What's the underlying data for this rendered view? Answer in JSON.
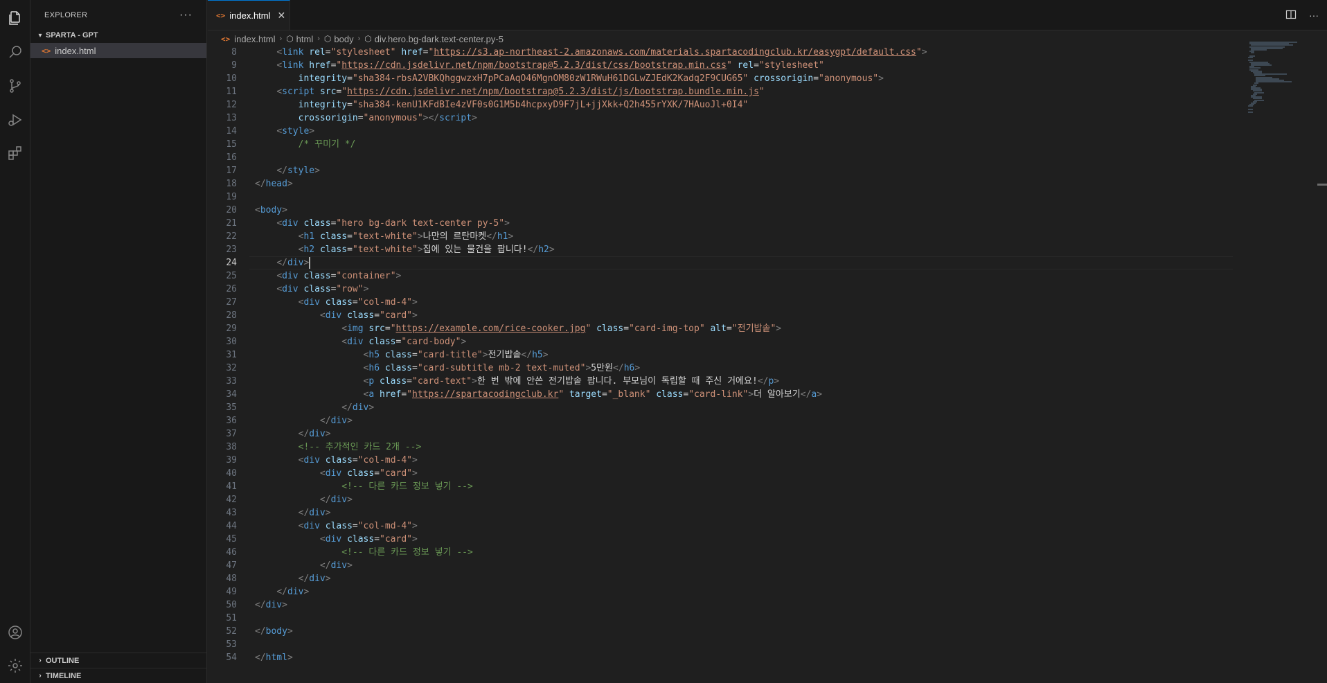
{
  "explorer": {
    "title": "EXPLORER",
    "more": "···",
    "project": "SPARTA - GPT",
    "files": [
      "index.html"
    ],
    "outline": "OUTLINE",
    "timeline": "TIMELINE"
  },
  "tab": {
    "label": "index.html",
    "close": "✕"
  },
  "breadcrumb": [
    "index.html",
    "html",
    "body",
    "div.hero.bg-dark.text-center.py-5"
  ],
  "editor": {
    "current_line": 24,
    "lines": [
      {
        "n": "8",
        "html": "    <span class='tg'>&lt;</span><span class='t'>link</span> <span class='at'>rel</span>=<span class='v'>\"stylesheet\"</span> <span class='at'>href</span>=<span class='v'>\"</span><span class='u'>https://s3.ap-northeast-2.amazonaws.com/materials.spartacodingclub.kr/easygpt/default.css</span><span class='v'>\"</span><span class='tg'>&gt;</span>"
      },
      {
        "n": "9",
        "html": "    <span class='tg'>&lt;</span><span class='t'>link</span> <span class='at'>href</span>=<span class='v'>\"</span><span class='u'>https://cdn.jsdelivr.net/npm/bootstrap@5.2.3/dist/css/bootstrap.min.css</span><span class='v'>\"</span> <span class='at'>rel</span>=<span class='v'>\"stylesheet\"</span>"
      },
      {
        "n": "10",
        "html": "        <span class='at'>integrity</span>=<span class='v'>\"sha384-rbsA2VBKQhggwzxH7pPCaAqO46MgnOM80zW1RWuH61DGLwZJEdK2Kadq2F9CUG65\"</span> <span class='at'>crossorigin</span>=<span class='v'>\"anonymous\"</span><span class='tg'>&gt;</span>"
      },
      {
        "n": "11",
        "html": "    <span class='tg'>&lt;</span><span class='t'>script</span> <span class='at'>src</span>=<span class='v'>\"</span><span class='u'>https://cdn.jsdelivr.net/npm/bootstrap@5.2.3/dist/js/bootstrap.bundle.min.js</span><span class='v'>\"</span>"
      },
      {
        "n": "12",
        "html": "        <span class='at'>integrity</span>=<span class='v'>\"sha384-kenU1KFdBIe4zVF0s0G1M5b4hcpxyD9F7jL+jjXkk+Q2h455rYXK/7HAuoJl+0I4\"</span>"
      },
      {
        "n": "13",
        "html": "        <span class='at'>crossorigin</span>=<span class='v'>\"anonymous\"</span><span class='tg'>&gt;&lt;/</span><span class='t'>script</span><span class='tg'>&gt;</span>"
      },
      {
        "n": "14",
        "html": "    <span class='tg'>&lt;</span><span class='t'>style</span><span class='tg'>&gt;</span>"
      },
      {
        "n": "15",
        "html": "        <span class='c'>/* 꾸미기 */</span>"
      },
      {
        "n": "16",
        "html": ""
      },
      {
        "n": "17",
        "html": "    <span class='tg'>&lt;/</span><span class='t'>style</span><span class='tg'>&gt;</span>"
      },
      {
        "n": "18",
        "html": "<span class='tg'>&lt;/</span><span class='t'>head</span><span class='tg'>&gt;</span>"
      },
      {
        "n": "19",
        "html": ""
      },
      {
        "n": "20",
        "html": "<span class='tg'>&lt;</span><span class='t'>body</span><span class='tg'>&gt;</span>"
      },
      {
        "n": "21",
        "html": "    <span class='tg'>&lt;</span><span class='t'>div</span> <span class='at'>class</span>=<span class='v'>\"hero bg-dark text-center py-5\"</span><span class='tg'>&gt;</span>"
      },
      {
        "n": "22",
        "html": "        <span class='tg'>&lt;</span><span class='t'>h1</span> <span class='at'>class</span>=<span class='v'>\"text-white\"</span><span class='tg'>&gt;</span><span class='w'>나만의 르탄마켓</span><span class='tg'>&lt;/</span><span class='t'>h1</span><span class='tg'>&gt;</span>"
      },
      {
        "n": "23",
        "html": "        <span class='tg'>&lt;</span><span class='t'>h2</span> <span class='at'>class</span>=<span class='v'>\"text-white\"</span><span class='tg'>&gt;</span><span class='w'>집에 있는 물건을 팝니다!</span><span class='tg'>&lt;/</span><span class='t'>h2</span><span class='tg'>&gt;</span>"
      },
      {
        "n": "24",
        "html": "    <span class='tg'>&lt;/</span><span class='t'>div</span><span class='tg'>&gt;</span><span class='cursor'></span>"
      },
      {
        "n": "25",
        "html": "    <span class='tg'>&lt;</span><span class='t'>div</span> <span class='at'>class</span>=<span class='v'>\"container\"</span><span class='tg'>&gt;</span>"
      },
      {
        "n": "26",
        "html": "    <span class='tg'>&lt;</span><span class='t'>div</span> <span class='at'>class</span>=<span class='v'>\"row\"</span><span class='tg'>&gt;</span>"
      },
      {
        "n": "27",
        "html": "        <span class='tg'>&lt;</span><span class='t'>div</span> <span class='at'>class</span>=<span class='v'>\"col-md-4\"</span><span class='tg'>&gt;</span>"
      },
      {
        "n": "28",
        "html": "            <span class='tg'>&lt;</span><span class='t'>div</span> <span class='at'>class</span>=<span class='v'>\"card\"</span><span class='tg'>&gt;</span>"
      },
      {
        "n": "29",
        "html": "                <span class='tg'>&lt;</span><span class='t'>img</span> <span class='at'>src</span>=<span class='v'>\"</span><span class='u'>https://example.com/rice-cooker.jpg</span><span class='v'>\"</span> <span class='at'>class</span>=<span class='v'>\"card-img-top\"</span> <span class='at'>alt</span>=<span class='v'>\"전기밥솥\"</span><span class='tg'>&gt;</span>"
      },
      {
        "n": "30",
        "html": "                <span class='tg'>&lt;</span><span class='t'>div</span> <span class='at'>class</span>=<span class='v'>\"card-body\"</span><span class='tg'>&gt;</span>"
      },
      {
        "n": "31",
        "html": "                    <span class='tg'>&lt;</span><span class='t'>h5</span> <span class='at'>class</span>=<span class='v'>\"card-title\"</span><span class='tg'>&gt;</span><span class='w'>전기밥솥</span><span class='tg'>&lt;/</span><span class='t'>h5</span><span class='tg'>&gt;</span>"
      },
      {
        "n": "32",
        "html": "                    <span class='tg'>&lt;</span><span class='t'>h6</span> <span class='at'>class</span>=<span class='v'>\"card-subtitle mb-2 text-muted\"</span><span class='tg'>&gt;</span><span class='w'>5만원</span><span class='tg'>&lt;/</span><span class='t'>h6</span><span class='tg'>&gt;</span>"
      },
      {
        "n": "33",
        "html": "                    <span class='tg'>&lt;</span><span class='t'>p</span> <span class='at'>class</span>=<span class='v'>\"card-text\"</span><span class='tg'>&gt;</span><span class='w'>한 번 밖에 안쓴 전기밥솥 팝니다. 부모님이 독립할 때 주신 거에요!</span><span class='tg'>&lt;/</span><span class='t'>p</span><span class='tg'>&gt;</span>"
      },
      {
        "n": "34",
        "html": "                    <span class='tg'>&lt;</span><span class='t'>a</span> <span class='at'>href</span>=<span class='v'>\"</span><span class='u'>https://spartacodingclub.kr</span><span class='v'>\"</span> <span class='at'>target</span>=<span class='v'>\"_blank\"</span> <span class='at'>class</span>=<span class='v'>\"card-link\"</span><span class='tg'>&gt;</span><span class='w'>더 알아보기</span><span class='tg'>&lt;/</span><span class='t'>a</span><span class='tg'>&gt;</span>"
      },
      {
        "n": "35",
        "html": "                <span class='tg'>&lt;/</span><span class='t'>div</span><span class='tg'>&gt;</span>"
      },
      {
        "n": "36",
        "html": "            <span class='tg'>&lt;/</span><span class='t'>div</span><span class='tg'>&gt;</span>"
      },
      {
        "n": "37",
        "html": "        <span class='tg'>&lt;/</span><span class='t'>div</span><span class='tg'>&gt;</span>"
      },
      {
        "n": "38",
        "html": "        <span class='c'>&lt;!-- 추가적인 카드 2개 --&gt;</span>"
      },
      {
        "n": "39",
        "html": "        <span class='tg'>&lt;</span><span class='t'>div</span> <span class='at'>class</span>=<span class='v'>\"col-md-4\"</span><span class='tg'>&gt;</span>"
      },
      {
        "n": "40",
        "html": "            <span class='tg'>&lt;</span><span class='t'>div</span> <span class='at'>class</span>=<span class='v'>\"card\"</span><span class='tg'>&gt;</span>"
      },
      {
        "n": "41",
        "html": "                <span class='c'>&lt;!-- 다른 카드 정보 넣기 --&gt;</span>"
      },
      {
        "n": "42",
        "html": "            <span class='tg'>&lt;/</span><span class='t'>div</span><span class='tg'>&gt;</span>"
      },
      {
        "n": "43",
        "html": "        <span class='tg'>&lt;/</span><span class='t'>div</span><span class='tg'>&gt;</span>"
      },
      {
        "n": "44",
        "html": "        <span class='tg'>&lt;</span><span class='t'>div</span> <span class='at'>class</span>=<span class='v'>\"col-md-4\"</span><span class='tg'>&gt;</span>"
      },
      {
        "n": "45",
        "html": "            <span class='tg'>&lt;</span><span class='t'>div</span> <span class='at'>class</span>=<span class='v'>\"card\"</span><span class='tg'>&gt;</span>"
      },
      {
        "n": "46",
        "html": "                <span class='c'>&lt;!-- 다른 카드 정보 넣기 --&gt;</span>"
      },
      {
        "n": "47",
        "html": "            <span class='tg'>&lt;/</span><span class='t'>div</span><span class='tg'>&gt;</span>"
      },
      {
        "n": "48",
        "html": "        <span class='tg'>&lt;/</span><span class='t'>div</span><span class='tg'>&gt;</span>"
      },
      {
        "n": "49",
        "html": "    <span class='tg'>&lt;/</span><span class='t'>div</span><span class='tg'>&gt;</span>"
      },
      {
        "n": "50",
        "html": "<span class='tg'>&lt;/</span><span class='t'>div</span><span class='tg'>&gt;</span>"
      },
      {
        "n": "51",
        "html": ""
      },
      {
        "n": "52",
        "html": "<span class='tg'>&lt;/</span><span class='t'>body</span><span class='tg'>&gt;</span>"
      },
      {
        "n": "53",
        "html": ""
      },
      {
        "n": "54",
        "html": "<span class='tg'>&lt;/</span><span class='t'>html</span><span class='tg'>&gt;</span>"
      }
    ]
  }
}
